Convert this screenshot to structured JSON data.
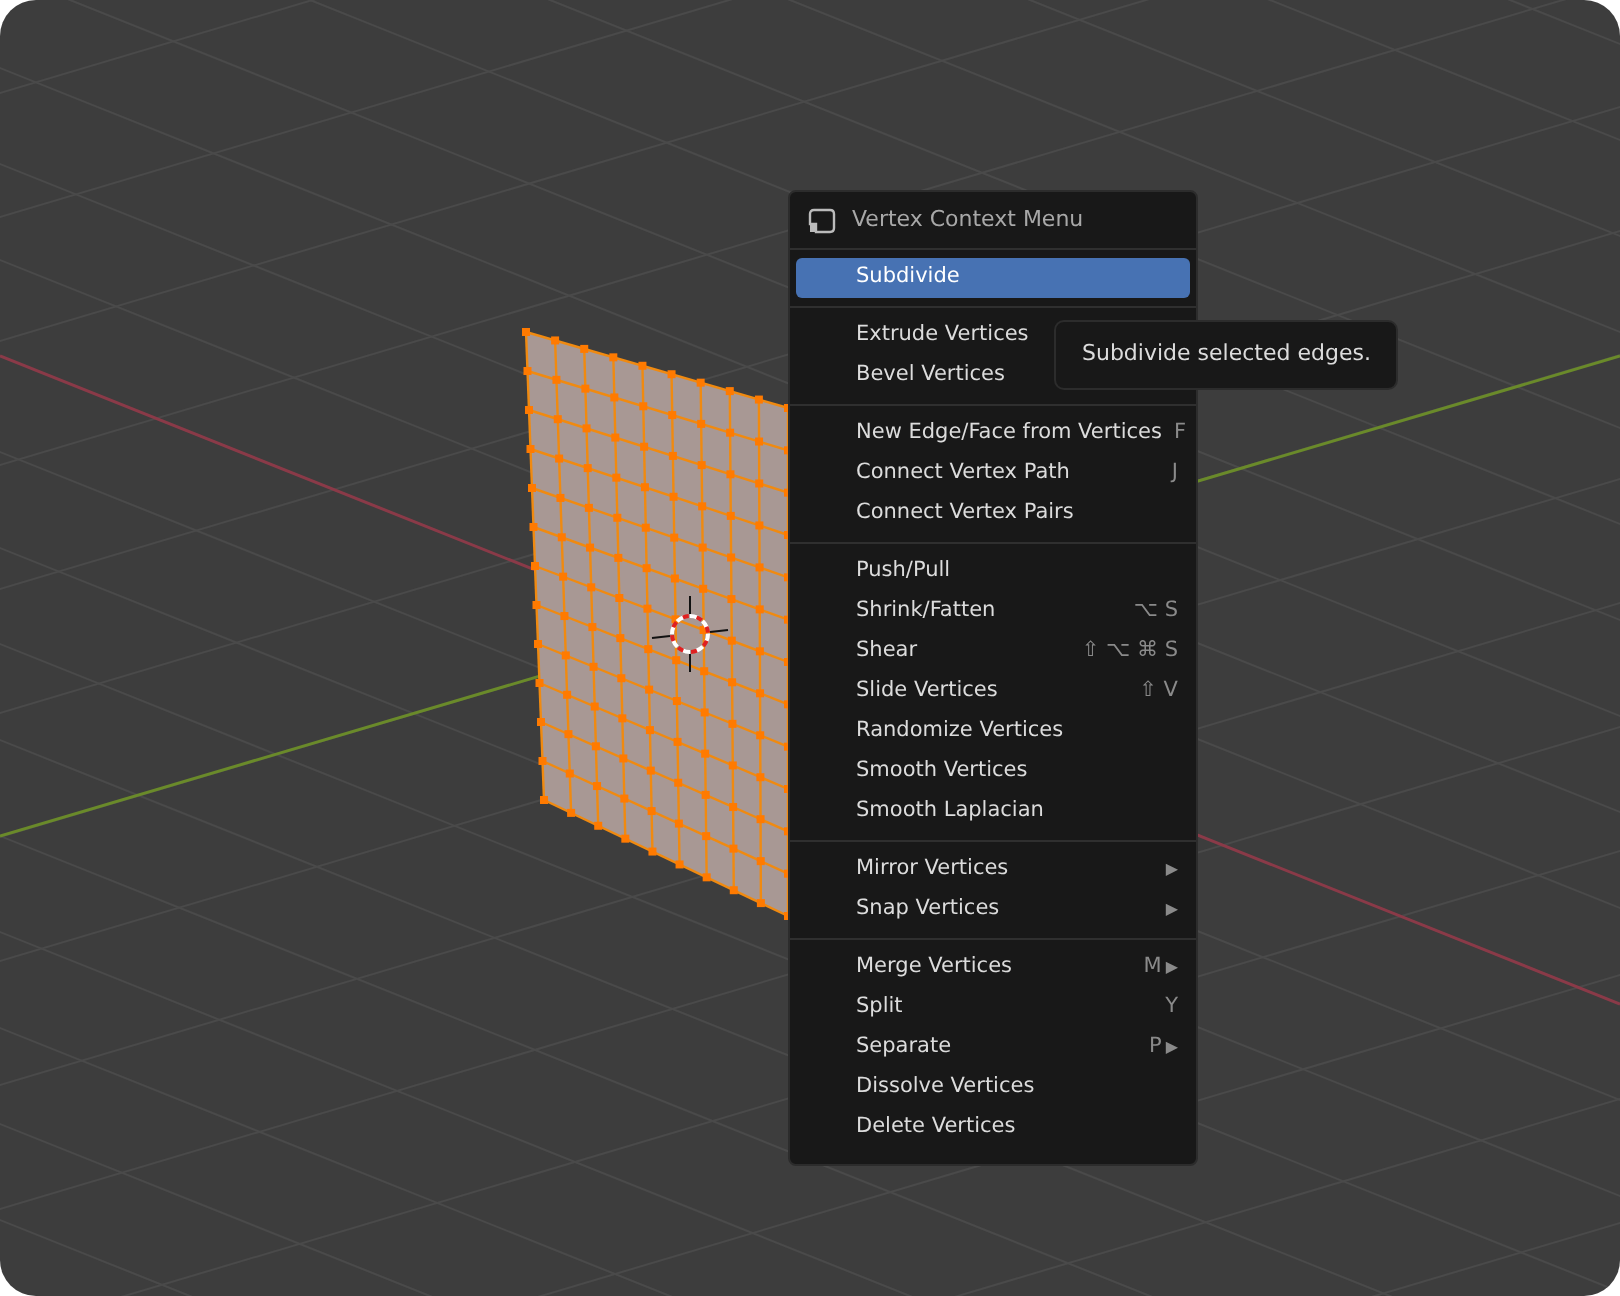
{
  "menu": {
    "title": "Vertex Context Menu",
    "sections": [
      {
        "items": [
          {
            "label": "Subdivide",
            "selected": true
          }
        ]
      },
      {
        "items": [
          {
            "label": "Extrude Vertices",
            "selected": false
          },
          {
            "label": "Bevel Vertices",
            "selected": false
          }
        ]
      },
      {
        "items": [
          {
            "label": "New Edge/Face from Vertices",
            "shortcut": "F",
            "selected": false
          },
          {
            "label": "Connect Vertex Path",
            "shortcut": "J",
            "selected": false
          },
          {
            "label": "Connect Vertex Pairs",
            "selected": false
          }
        ]
      },
      {
        "items": [
          {
            "label": "Push/Pull",
            "selected": false
          },
          {
            "label": "Shrink/Fatten",
            "shortcut": "⌥ S",
            "selected": false
          },
          {
            "label": "Shear",
            "shortcut": "⇧ ⌥ ⌘ S",
            "selected": false
          },
          {
            "label": "Slide Vertices",
            "shortcut": "⇧ V",
            "selected": false
          },
          {
            "label": "Randomize Vertices",
            "selected": false
          },
          {
            "label": "Smooth Vertices",
            "selected": false
          },
          {
            "label": "Smooth Laplacian",
            "selected": false
          }
        ]
      },
      {
        "items": [
          {
            "label": "Mirror Vertices",
            "arrow": "▶",
            "selected": false
          },
          {
            "label": "Snap Vertices",
            "arrow": "▶",
            "selected": false
          }
        ]
      },
      {
        "items": [
          {
            "label": "Merge Vertices",
            "shortcut": "M",
            "arrow": "▶",
            "selected": false
          },
          {
            "label": "Split",
            "shortcut": "Y",
            "selected": false
          },
          {
            "label": "Separate",
            "shortcut": "P",
            "arrow": "▶",
            "selected": false
          },
          {
            "label": "Dissolve Vertices",
            "selected": false
          },
          {
            "label": "Delete Vertices",
            "selected": false
          }
        ]
      }
    ]
  },
  "tooltip": {
    "text": "Subdivide selected edges."
  }
}
